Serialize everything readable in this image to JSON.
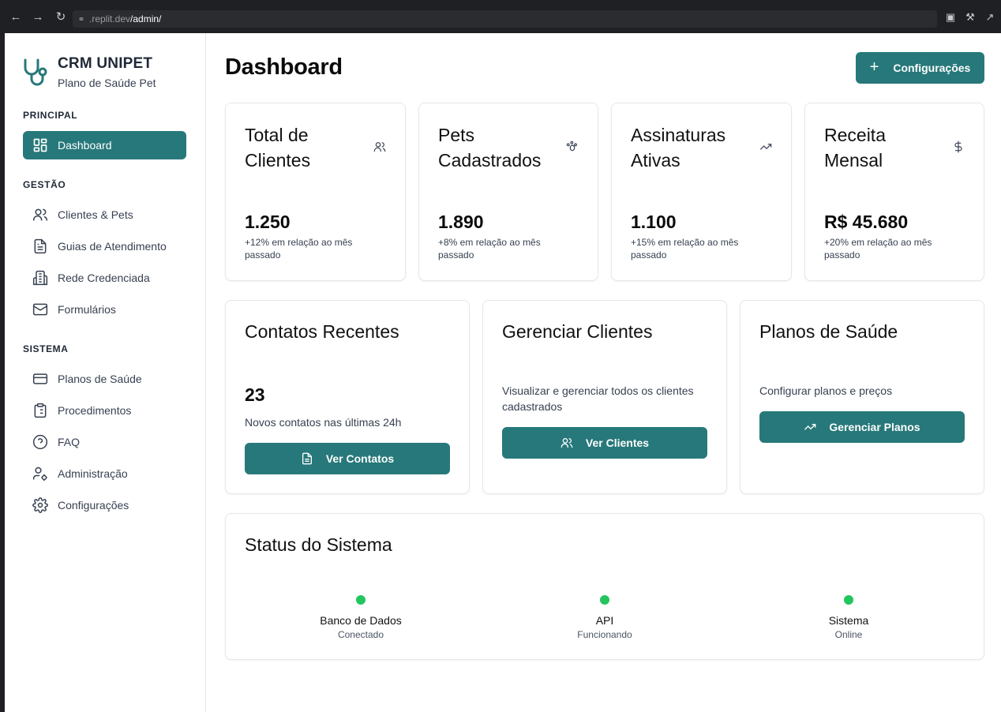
{
  "browser": {
    "url_host": ".replit.dev",
    "url_path": "/admin/"
  },
  "brand": {
    "title": "CRM UNIPET",
    "subtitle": "Plano de Saúde Pet"
  },
  "sidebar": {
    "sections": [
      {
        "label": "PRINCIPAL"
      },
      {
        "label": "GESTÃO"
      },
      {
        "label": "SISTEMA"
      }
    ],
    "items": [
      {
        "label": "Dashboard",
        "icon": "dashboard-icon",
        "active": true
      },
      {
        "label": "Clientes & Pets",
        "icon": "users-icon"
      },
      {
        "label": "Guias de Atendimento",
        "icon": "file-icon"
      },
      {
        "label": "Rede Credenciada",
        "icon": "building-icon"
      },
      {
        "label": "Formulários",
        "icon": "mail-icon"
      },
      {
        "label": "Planos de Saúde",
        "icon": "credit-card-icon"
      },
      {
        "label": "Procedimentos",
        "icon": "clipboard-list-icon"
      },
      {
        "label": "FAQ",
        "icon": "help-circle-icon"
      },
      {
        "label": "Administração",
        "icon": "user-cog-icon"
      },
      {
        "label": "Configurações",
        "icon": "gear-icon"
      }
    ]
  },
  "header": {
    "title": "Dashboard",
    "config_button": "Configurações"
  },
  "stats": [
    {
      "title": "Total de Clientes",
      "value": "1.250",
      "change": "+12% em relação ao mês passado",
      "icon": "users-icon"
    },
    {
      "title": "Pets Cadastrados",
      "value": "1.890",
      "change": "+8% em relação ao mês passado",
      "icon": "paw-icon"
    },
    {
      "title": "Assinaturas Ativas",
      "value": "1.100",
      "change": "+15% em relação ao mês passado",
      "icon": "trending-up-icon"
    },
    {
      "title": "Receita Mensal",
      "value": "R$ 45.680",
      "change": "+20% em relação ao mês passado",
      "icon": "dollar-icon"
    }
  ],
  "actions": [
    {
      "title": "Contatos Recentes",
      "value": "23",
      "text": "Novos contatos nas últimas 24h",
      "button": "Ver Contatos",
      "icon": "file-text-icon"
    },
    {
      "title": "Gerenciar Clientes",
      "text": "Visualizar e gerenciar todos os clientes cadastrados",
      "button": "Ver Clientes",
      "icon": "users-icon"
    },
    {
      "title": "Planos de Saúde",
      "text": "Configurar planos e preços",
      "button": "Gerenciar Planos",
      "icon": "trending-up-icon"
    }
  ],
  "status": {
    "title": "Status do Sistema",
    "items": [
      {
        "name": "Banco de Dados",
        "state": "Conectado",
        "color": "#22c55e"
      },
      {
        "name": "API",
        "state": "Funcionando",
        "color": "#22c55e"
      },
      {
        "name": "Sistema",
        "state": "Online",
        "color": "#22c55e"
      }
    ]
  },
  "colors": {
    "primary": "#27787a",
    "status_ok": "#22c55e"
  }
}
